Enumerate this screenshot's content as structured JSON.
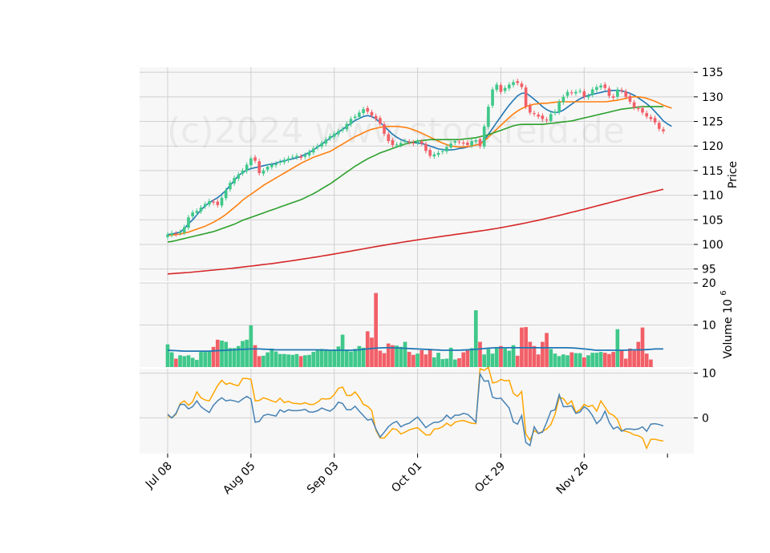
{
  "watermark": "(c)2024 www.stockfeld.de",
  "colors": {
    "up": "#3fc88a",
    "down": "#f25f67",
    "panel_bg": "#f7f7f7",
    "grid": "#d0d0d0",
    "ma_short": "#1f77b4",
    "ma_mid": "#ff7f0e",
    "ma_long": "#2ca02c",
    "ma_200": "#d62728",
    "vol_ma": "#1f77b4",
    "ind_line": "#4682b4",
    "ind_signal": "#ffa500"
  },
  "chart_data": {
    "type": "candlestick",
    "x_ticks": [
      "Jul 08",
      "Aug 05",
      "Sep 03",
      "Oct 01",
      "Oct 29",
      "Nov 26"
    ],
    "x_tick_indices": [
      0,
      20,
      40,
      60,
      80,
      100
    ],
    "n_bars": 120,
    "price": {
      "ylabel": "Price",
      "ylim": [
        92.5,
        136
      ],
      "yticks": [
        95,
        100,
        105,
        110,
        115,
        120,
        125,
        130,
        135
      ],
      "close": [
        102.0,
        102.3,
        102.1,
        102.5,
        103.5,
        105.5,
        106.5,
        106.8,
        107.5,
        108.2,
        108.8,
        108.5,
        108.0,
        109.5,
        111.0,
        112.5,
        113.5,
        114.2,
        115.0,
        116.2,
        117.5,
        117.0,
        114.5,
        115.0,
        115.8,
        116.2,
        116.4,
        116.8,
        117.2,
        117.5,
        117.8,
        118.0,
        117.6,
        118.2,
        118.8,
        119.5,
        120.0,
        120.6,
        121.3,
        122.0,
        122.5,
        123.0,
        123.5,
        124.5,
        125.5,
        126.0,
        126.8,
        127.5,
        127.0,
        126.2,
        125.5,
        124.5,
        122.5,
        121.0,
        120.2,
        120.3,
        120.6,
        121.0,
        120.8,
        120.5,
        121.0,
        120.5,
        119.0,
        118.0,
        118.3,
        118.6,
        119.0,
        119.8,
        120.5,
        121.0,
        120.8,
        120.5,
        120.2,
        121.0,
        121.2,
        120.0,
        124.0,
        128.0,
        131.5,
        132.5,
        131.0,
        131.8,
        132.5,
        133.0,
        132.8,
        132.0,
        128.0,
        126.8,
        126.5,
        126.0,
        125.5,
        125.2,
        126.5,
        127.0,
        129.0,
        130.0,
        131.0,
        130.8,
        131.0,
        131.2,
        130.0,
        130.2,
        131.5,
        132.0,
        132.3,
        131.8,
        130.2,
        129.8,
        131.5,
        131.2,
        130.0,
        129.0,
        127.8,
        127.5,
        126.8,
        126.0,
        125.5,
        124.8,
        123.5,
        123.0
      ],
      "overlays": [
        {
          "name": "MA short",
          "color_key": "ma_short",
          "values": [
            102.0,
            102.1,
            102.3,
            102.5,
            103.2,
            104.2,
            105.0,
            106.0,
            107.0,
            107.8,
            108.5,
            109.0,
            109.5,
            110.2,
            111.0,
            112.0,
            113.0,
            114.0,
            114.6,
            115.1,
            115.4,
            115.6,
            115.8,
            116.0,
            116.2,
            116.3,
            116.5,
            116.8,
            117.0,
            117.2,
            117.4,
            117.6,
            117.9,
            118.3,
            118.7,
            119.2,
            119.8,
            120.4,
            121.0,
            121.6,
            122.2,
            122.8,
            123.4,
            124.0,
            124.6,
            125.2,
            125.6,
            126.0,
            126.2,
            126.0,
            125.5,
            124.8,
            124.0,
            123.2,
            122.4,
            121.8,
            121.3,
            121.0,
            120.8,
            120.7,
            120.6,
            120.5,
            120.3,
            120.0,
            119.7,
            119.4,
            119.3,
            119.2,
            119.2,
            119.3,
            119.5,
            119.6,
            119.8,
            120.0,
            120.2,
            120.4,
            121.2,
            122.4,
            123.6,
            124.8,
            126.0,
            127.2,
            128.3,
            129.3,
            130.2,
            130.7,
            130.8,
            130.2,
            129.5,
            128.8,
            128.0,
            127.4,
            127.0,
            126.8,
            126.9,
            127.3,
            127.9,
            128.5,
            129.1,
            129.6,
            130.0,
            130.3,
            130.5,
            130.7,
            130.9,
            131.1,
            131.2,
            131.3,
            131.3,
            131.2,
            131.0,
            130.7,
            130.3,
            129.8,
            129.2,
            128.6,
            127.9,
            127.0,
            126.1,
            125.1,
            124.5,
            124.0
          ]
        },
        {
          "name": "MA mid",
          "color_key": "ma_mid",
          "values": [
            101.8,
            101.9,
            102.0,
            102.1,
            102.3,
            102.5,
            102.8,
            103.1,
            103.4,
            103.7,
            104.1,
            104.5,
            105.0,
            105.5,
            106.1,
            106.8,
            107.5,
            108.2,
            109.0,
            109.6,
            110.2,
            110.8,
            111.4,
            112.0,
            112.5,
            113.0,
            113.5,
            114.0,
            114.5,
            115.0,
            115.5,
            116.0,
            116.5,
            116.9,
            117.3,
            117.7,
            118.0,
            118.3,
            118.6,
            118.9,
            119.4,
            119.9,
            120.4,
            120.9,
            121.4,
            121.9,
            122.3,
            122.7,
            123.1,
            123.4,
            123.6,
            123.8,
            123.9,
            124.0,
            124.0,
            124.0,
            123.9,
            123.8,
            123.6,
            123.3,
            123.0,
            122.6,
            122.2,
            121.8,
            121.4,
            121.0,
            120.6,
            120.3,
            120.0,
            119.9,
            119.8,
            119.8,
            119.9,
            120.0,
            120.2,
            120.4,
            121.0,
            121.8,
            122.6,
            123.4,
            124.2,
            125.0,
            125.8,
            126.5,
            127.1,
            127.6,
            128.0,
            128.3,
            128.5,
            128.6,
            128.7,
            128.7,
            128.8,
            128.9,
            129.0,
            129.0,
            129.0,
            129.0,
            129.0,
            129.0,
            129.0,
            129.0,
            129.0,
            129.0,
            129.0,
            129.0,
            129.1,
            129.2,
            129.3,
            129.5,
            129.7,
            129.9,
            130.0,
            130.0,
            129.9,
            129.7,
            129.4,
            129.1,
            128.7,
            128.3,
            128.0,
            127.7
          ]
        },
        {
          "name": "MA long",
          "color_key": "ma_long",
          "values": [
            100.5,
            100.6,
            100.8,
            101.0,
            101.2,
            101.4,
            101.6,
            101.8,
            102.0,
            102.2,
            102.4,
            102.6,
            102.9,
            103.2,
            103.5,
            103.8,
            104.1,
            104.5,
            104.9,
            105.2,
            105.5,
            105.8,
            106.1,
            106.4,
            106.7,
            107.0,
            107.3,
            107.6,
            107.9,
            108.2,
            108.5,
            108.8,
            109.1,
            109.5,
            109.9,
            110.3,
            110.8,
            111.3,
            111.8,
            112.3,
            112.9,
            113.5,
            114.1,
            114.7,
            115.3,
            115.9,
            116.4,
            116.9,
            117.4,
            117.8,
            118.2,
            118.6,
            118.9,
            119.2,
            119.5,
            119.8,
            120.1,
            120.4,
            120.6,
            120.8,
            121.0,
            121.1,
            121.2,
            121.3,
            121.3,
            121.3,
            121.3,
            121.3,
            121.3,
            121.3,
            121.3,
            121.4,
            121.5,
            121.6,
            121.7,
            121.9,
            122.1,
            122.3,
            122.6,
            122.9,
            123.2,
            123.5,
            123.8,
            124.1,
            124.3,
            124.4,
            124.4,
            124.4,
            124.4,
            124.4,
            124.4,
            124.5,
            124.6,
            124.7,
            124.8,
            124.9,
            125.0,
            125.1,
            125.3,
            125.5,
            125.7,
            125.9,
            126.1,
            126.3,
            126.5,
            126.7,
            126.9,
            127.1,
            127.3,
            127.5,
            127.6,
            127.7,
            127.8,
            127.9,
            128.0,
            128.0,
            128.0,
            128.0,
            128.0,
            128.0
          ]
        },
        {
          "name": "MA 200",
          "color_key": "ma_200",
          "values": [
            94.0,
            94.06,
            94.12,
            94.18,
            94.24,
            94.3,
            94.38,
            94.46,
            94.54,
            94.62,
            94.7,
            94.78,
            94.86,
            94.94,
            95.02,
            95.1,
            95.2,
            95.3,
            95.4,
            95.5,
            95.6,
            95.7,
            95.8,
            95.9,
            96.0,
            96.1,
            96.22,
            96.34,
            96.46,
            96.58,
            96.7,
            96.83,
            96.96,
            97.09,
            97.22,
            97.35,
            97.49,
            97.63,
            97.77,
            97.91,
            98.05,
            98.2,
            98.35,
            98.5,
            98.65,
            98.8,
            98.95,
            99.1,
            99.25,
            99.4,
            99.55,
            99.7,
            99.84,
            99.98,
            100.12,
            100.26,
            100.4,
            100.53,
            100.66,
            100.79,
            100.92,
            101.05,
            101.17,
            101.29,
            101.41,
            101.53,
            101.65,
            101.77,
            101.89,
            102.01,
            102.13,
            102.25,
            102.37,
            102.49,
            102.61,
            102.73,
            102.85,
            102.98,
            103.12,
            103.26,
            103.4,
            103.56,
            103.72,
            103.88,
            104.04,
            104.2,
            104.38,
            104.56,
            104.74,
            104.92,
            105.1,
            105.3,
            105.5,
            105.7,
            105.9,
            106.1,
            106.31,
            106.52,
            106.73,
            106.94,
            107.15,
            107.37,
            107.59,
            107.81,
            108.03,
            108.25,
            108.47,
            108.69,
            108.91,
            109.13,
            109.35,
            109.56,
            109.77,
            109.98,
            110.19,
            110.4,
            110.6,
            110.8,
            111.0,
            111.2
          ]
        }
      ]
    },
    "volume": {
      "ylabel": "Volume  10^6",
      "ylim": [
        0,
        20
      ],
      "yticks": [
        10,
        20
      ],
      "values": [
        5.4,
        3.5,
        2.0,
        2.8,
        2.6,
        2.8,
        2.2,
        1.7,
        3.6,
        3.6,
        3.7,
        4.8,
        6.5,
        6.3,
        6.0,
        4.5,
        4.5,
        5.0,
        6.2,
        6.5,
        9.9,
        5.2,
        2.6,
        2.7,
        3.5,
        4.4,
        3.7,
        3.1,
        3.1,
        3.0,
        2.9,
        3.1,
        2.6,
        2.8,
        2.9,
        3.6,
        4.0,
        4.3,
        4.0,
        3.9,
        4.2,
        4.9,
        7.7,
        4.0,
        3.7,
        4.3,
        5.0,
        4.6,
        8.5,
        7.0,
        17.6,
        3.9,
        3.3,
        5.6,
        5.2,
        5.1,
        4.8,
        6.0,
        3.6,
        2.9,
        3.2,
        4.0,
        3.0,
        4.3,
        2.3,
        3.4,
        1.9,
        2.0,
        4.6,
        1.8,
        2.1,
        3.5,
        4.1,
        4.5,
        13.5,
        6.0,
        3.0,
        4.3,
        3.2,
        4.5,
        5.0,
        4.4,
        3.9,
        5.2,
        2.7,
        9.4,
        9.5,
        6.0,
        5.0,
        3.0,
        6.0,
        8.1,
        4.3,
        3.2,
        2.6,
        3.0,
        2.8,
        3.5,
        3.3,
        3.3,
        2.3,
        2.8,
        3.4,
        3.4,
        3.6,
        3.4,
        3.1,
        3.6,
        9.0,
        4.0,
        2.0,
        4.4,
        3.9,
        6.0,
        9.4,
        3.2,
        1.8
      ],
      "ma": [
        4.0,
        3.95,
        3.9,
        3.85,
        3.8,
        3.8,
        3.8,
        3.8,
        3.8,
        3.8,
        3.8,
        3.85,
        3.9,
        3.95,
        4.0,
        4.05,
        4.1,
        4.15,
        4.2,
        4.25,
        4.3,
        4.3,
        4.3,
        4.25,
        4.2,
        4.15,
        4.1,
        4.1,
        4.1,
        4.1,
        4.1,
        4.1,
        4.1,
        4.1,
        4.1,
        4.1,
        4.1,
        4.05,
        4.05,
        4.0,
        4.0,
        4.0,
        4.0,
        4.0,
        4.0,
        4.05,
        4.1,
        4.2,
        4.3,
        4.4,
        4.5,
        4.55,
        4.6,
        4.6,
        4.6,
        4.55,
        4.5,
        4.45,
        4.4,
        4.35,
        4.3,
        4.25,
        4.2,
        4.15,
        4.1,
        4.05,
        4.0,
        4.0,
        4.0,
        4.0,
        4.0,
        4.05,
        4.1,
        4.15,
        4.2,
        4.3,
        4.4,
        4.5,
        4.55,
        4.6,
        4.6,
        4.6,
        4.6,
        4.6,
        4.6,
        4.6,
        4.6,
        4.6,
        4.6,
        4.6,
        4.6,
        4.6,
        4.6,
        4.6,
        4.6,
        4.6,
        4.6,
        4.55,
        4.5,
        4.4,
        4.3,
        4.2,
        4.1,
        4.0,
        4.0,
        4.0,
        4.0,
        4.0,
        4.0,
        4.0,
        4.0,
        4.1,
        4.1,
        4.1,
        4.1,
        4.15,
        4.2,
        4.3,
        4.3,
        4.3
      ]
    },
    "indicator": {
      "ylim": [
        -8,
        11
      ],
      "yticks": [
        0,
        10
      ],
      "line": [
        0.8,
        0.0,
        1.0,
        3.0,
        3.0,
        2.0,
        2.5,
        3.8,
        2.5,
        1.8,
        1.2,
        2.8,
        3.8,
        4.5,
        3.8,
        4.0,
        3.8,
        3.5,
        4.2,
        4.8,
        4.2,
        -1.0,
        -0.8,
        0.5,
        0.8,
        0.6,
        0.4,
        1.8,
        1.3,
        1.8,
        1.6,
        1.6,
        1.7,
        1.9,
        1.3,
        1.3,
        1.6,
        2.2,
        1.8,
        1.5,
        2.2,
        3.5,
        3.2,
        1.8,
        1.8,
        2.6,
        1.5,
        0.5,
        -0.5,
        -0.3,
        -2.5,
        -4.3,
        -3.2,
        -2.0,
        -1.2,
        -0.8,
        -2.0,
        -1.5,
        -1.2,
        -0.5,
        0.2,
        -1.0,
        -2.2,
        -1.5,
        -1.0,
        -1.0,
        -0.5,
        0.6,
        -0.2,
        0.6,
        0.6,
        1.0,
        0.8,
        0.0,
        -1.0,
        9.8,
        8.2,
        8.3,
        4.6,
        4.3,
        4.4,
        3.3,
        2.2,
        -0.9,
        -1.4,
        0.5,
        -5.5,
        -6.2,
        -2.0,
        -3.5,
        -3.2,
        -1.0,
        1.5,
        1.8,
        5.2,
        2.5,
        2.5,
        2.7,
        1.0,
        1.3,
        2.5,
        1.8,
        0.5,
        -1.3,
        -0.4,
        1.5,
        -1.0,
        -2.5,
        -2.0,
        -3.0,
        -2.5,
        -2.5,
        -2.6,
        -2.5,
        -2.0,
        -3.0,
        -1.4,
        -1.3,
        -1.5,
        -1.8
      ],
      "signal": [
        0.5,
        0.0,
        0.8,
        3.2,
        3.8,
        2.8,
        3.6,
        5.8,
        4.5,
        4.0,
        3.8,
        5.5,
        7.2,
        8.4,
        7.5,
        7.8,
        7.4,
        7.2,
        8.8,
        8.8,
        8.6,
        3.8,
        3.9,
        4.5,
        4.2,
        3.8,
        3.5,
        4.4,
        3.4,
        3.7,
        3.3,
        3.2,
        3.1,
        3.4,
        3.0,
        3.0,
        3.5,
        4.3,
        4.2,
        4.3,
        5.2,
        6.6,
        6.9,
        5.0,
        5.0,
        5.8,
        4.6,
        3.0,
        2.6,
        1.6,
        -2.8,
        -4.5,
        -4.5,
        -3.5,
        -2.4,
        -2.6,
        -3.6,
        -3.2,
        -2.7,
        -2.4,
        -2.2,
        -3.0,
        -3.8,
        -3.8,
        -2.5,
        -2.4,
        -2.0,
        -1.2,
        -1.8,
        -1.0,
        -0.7,
        -0.6,
        -0.9,
        -1.2,
        -1.3,
        11.0,
        10.6,
        11.3,
        7.8,
        8.0,
        8.6,
        8.3,
        8.4,
        5.5,
        4.8,
        5.9,
        -3.6,
        -5.0,
        -2.8,
        -3.5,
        -3.0,
        -2.5,
        -1.5,
        0.8,
        4.6,
        4.3,
        3.0,
        3.8,
        1.2,
        1.8,
        3.0,
        2.5,
        2.8,
        1.5,
        3.8,
        2.4,
        1.0,
        0.6,
        -0.4,
        -2.8,
        -3.0,
        -3.3,
        -3.8,
        -4.0,
        -4.5,
        -6.8,
        -4.8,
        -4.8,
        -5.0,
        -5.2
      ]
    }
  }
}
